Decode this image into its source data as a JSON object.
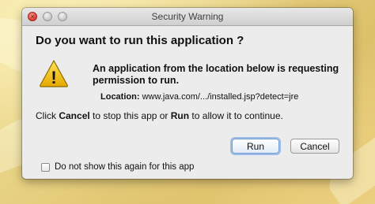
{
  "window": {
    "title": "Security Warning"
  },
  "dialog": {
    "heading": "Do you want to run this application ?",
    "message": "An application from the location below is requesting permission to run.",
    "location_label": "Location:",
    "location_value": "www.java.com/.../installed.jsp?detect=jre",
    "instruction_pre": "Click ",
    "instruction_cancel": "Cancel",
    "instruction_mid": " to stop this app or ",
    "instruction_run": "Run",
    "instruction_post": " to allow it to continue."
  },
  "buttons": {
    "run_label": "Run",
    "cancel_label": "Cancel"
  },
  "checkbox": {
    "label": "Do not show this again for this app",
    "checked": false
  },
  "icons": {
    "close": "close-icon",
    "x_glyph": "×",
    "warning": "warning-icon",
    "warning_glyph": "!"
  },
  "colors": {
    "warning_fill": "#f2c200",
    "default_button_border": "#7a9ed0"
  }
}
